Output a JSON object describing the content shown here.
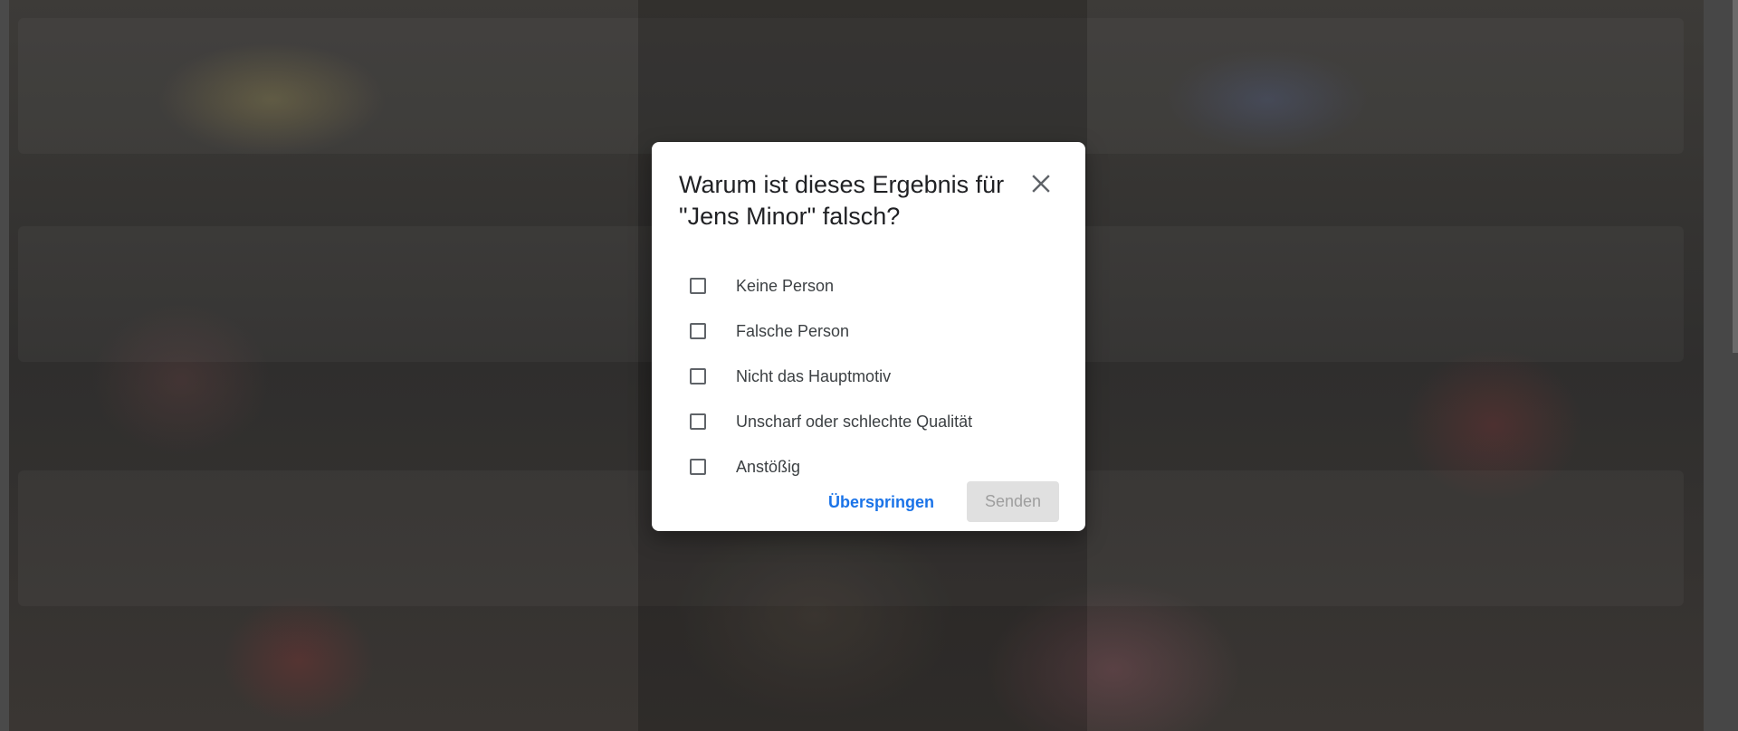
{
  "dialog": {
    "title": "Warum ist dieses Ergebnis für \"Jens Minor\" falsch?",
    "close_icon": "close-icon",
    "options": [
      {
        "label": "Keine Person",
        "checked": false
      },
      {
        "label": "Falsche Person",
        "checked": false
      },
      {
        "label": "Nicht das Hauptmotiv",
        "checked": false
      },
      {
        "label": "Unscharf oder schlechte Qualität",
        "checked": false
      },
      {
        "label": "Anstößig",
        "checked": false
      }
    ],
    "skip_label": "Überspringen",
    "send_label": "Senden"
  },
  "colors": {
    "accent": "#1a73e8",
    "disabled_bg": "#e0e0e0",
    "disabled_text": "#9e9e9e"
  }
}
